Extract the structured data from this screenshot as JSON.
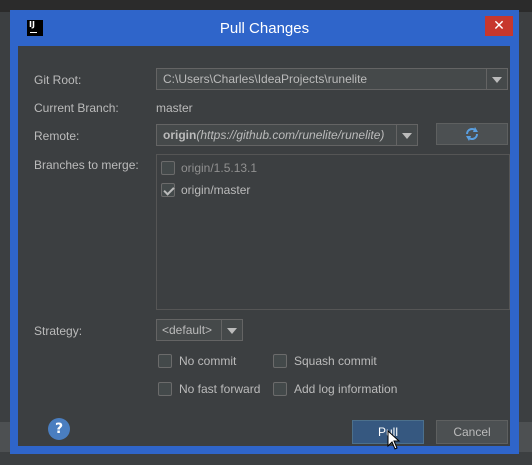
{
  "window": {
    "title": "Pull Changes",
    "close_label": "✕",
    "app_icon_text": "IJ"
  },
  "form": {
    "git_root_label": "Git Root:",
    "git_root_value": "C:\\Users\\Charles\\IdeaProjects\\runelite",
    "current_branch_label": "Current Branch:",
    "current_branch_value": "master",
    "remote_label": "Remote:",
    "remote_name": "origin",
    "remote_url": "(https://github.com/runelite/runelite)",
    "branches_label": "Branches to merge:",
    "strategy_label": "Strategy:",
    "strategy_value": "<default>"
  },
  "branches": [
    {
      "label": "origin/1.5.13.1",
      "checked": false
    },
    {
      "label": "origin/master",
      "checked": true
    }
  ],
  "options": {
    "no_commit": "No commit",
    "squash_commit": "Squash commit",
    "no_fast_forward": "No fast forward",
    "add_log_information": "Add log information"
  },
  "buttons": {
    "pull": "Pull",
    "cancel": "Cancel",
    "help": "?"
  },
  "colors": {
    "title_bar": "#2f65ca",
    "background": "#3c3f41",
    "accent": "#365880",
    "close": "#c7372d"
  }
}
